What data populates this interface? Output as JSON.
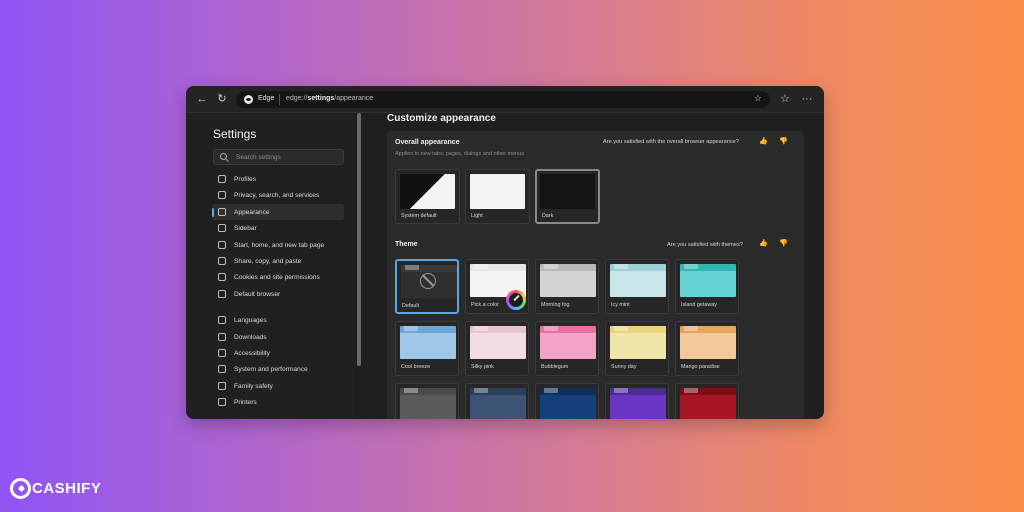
{
  "browser": {
    "site_name": "Edge",
    "url_prefix": "edge://",
    "url_bold": "settings",
    "url_suffix": "/appearance"
  },
  "sidebar": {
    "title": "Settings",
    "search_placeholder": "Search settings",
    "items": [
      {
        "label": "Profiles",
        "icon": "profile-icon"
      },
      {
        "label": "Privacy, search, and services",
        "icon": "lock-icon"
      },
      {
        "label": "Appearance",
        "icon": "appearance-icon",
        "active": true
      },
      {
        "label": "Sidebar",
        "icon": "sidebar-icon"
      },
      {
        "label": "Start, home, and new tab page",
        "icon": "home-icon"
      },
      {
        "label": "Share, copy, and paste",
        "icon": "share-icon"
      },
      {
        "label": "Cookies and site permissions",
        "icon": "cookie-icon"
      },
      {
        "label": "Default browser",
        "icon": "browser-icon"
      },
      {
        "label": "Languages",
        "icon": "language-icon"
      },
      {
        "label": "Downloads",
        "icon": "download-icon"
      },
      {
        "label": "Accessibility",
        "icon": "accessibility-icon"
      },
      {
        "label": "System and performance",
        "icon": "system-icon"
      },
      {
        "label": "Family safety",
        "icon": "family-icon"
      },
      {
        "label": "Printers",
        "icon": "printer-icon"
      }
    ]
  },
  "main": {
    "title": "Customize appearance",
    "overall": {
      "title": "Overall appearance",
      "subtitle": "Applies to new tabs, pages, dialogs and other menus",
      "question": "Are you satisfied with the overall browser appearance?",
      "options": [
        "System default",
        "Light",
        "Dark"
      ],
      "selected": "Dark"
    },
    "theme": {
      "title": "Theme",
      "question": "Are you satisfied with themes?",
      "options": [
        {
          "label": "Default",
          "top": "#3a3a3a",
          "body": "#2f2f2f",
          "selected": true
        },
        {
          "label": "Pick a color",
          "top": "#e6e6e6",
          "body": "#f5f5f5"
        },
        {
          "label": "Morning fog",
          "top": "#b9b9b9",
          "body": "#d4d4d4"
        },
        {
          "label": "Icy mint",
          "top": "#9fd0d6",
          "body": "#c8e5e9"
        },
        {
          "label": "Island getaway",
          "top": "#36b5b5",
          "body": "#62d2d2"
        },
        {
          "label": "Cool breeze",
          "top": "#6ea7d6",
          "body": "#9fc7e8"
        },
        {
          "label": "Silky pink",
          "top": "#e8c4cf",
          "body": "#f3dde3"
        },
        {
          "label": "Bubblegum",
          "top": "#e76fa2",
          "body": "#f3a3c6"
        },
        {
          "label": "Sunny day",
          "top": "#e8d57d",
          "body": "#f1e6a9"
        },
        {
          "label": "Mango paradise",
          "top": "#e7a45f",
          "body": "#f3c89a"
        },
        {
          "label": "",
          "top": "#4a4a4a",
          "body": "#5a5a5a"
        },
        {
          "label": "",
          "top": "#2c3f5a",
          "body": "#3c5375"
        },
        {
          "label": "",
          "top": "#0e2f5c",
          "body": "#153f7b"
        },
        {
          "label": "",
          "top": "#4c2a92",
          "body": "#6936c4"
        },
        {
          "label": "",
          "top": "#7a0f1a",
          "body": "#a51622"
        }
      ]
    }
  },
  "watermark": "CASHIFY"
}
